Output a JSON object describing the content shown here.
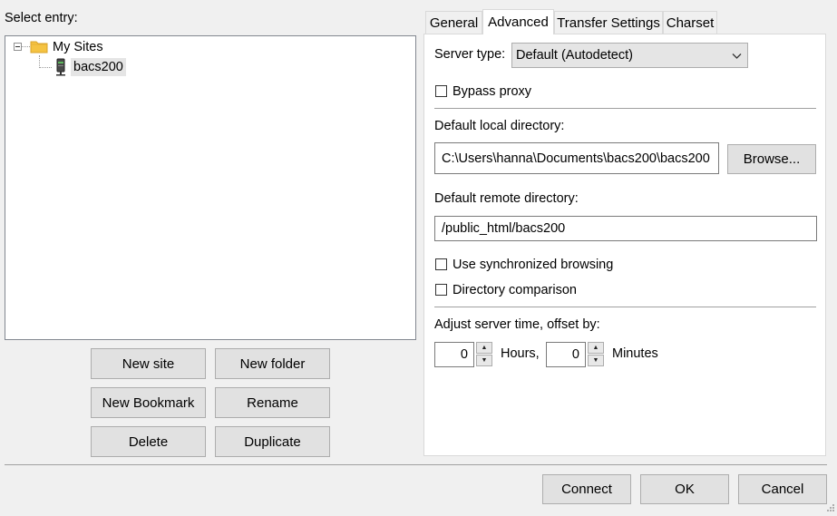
{
  "left": {
    "select_entry_label": "Select entry:",
    "tree": {
      "root_label": "My Sites",
      "child_label": "bacs200"
    },
    "buttons": {
      "new_site": "New site",
      "new_folder": "New folder",
      "new_bookmark": "New Bookmark",
      "rename": "Rename",
      "delete": "Delete",
      "duplicate": "Duplicate"
    }
  },
  "tabs": [
    {
      "label": "General",
      "active": false
    },
    {
      "label": "Advanced",
      "active": true
    },
    {
      "label": "Transfer Settings",
      "active": false
    },
    {
      "label": "Charset",
      "active": false
    }
  ],
  "advanced": {
    "server_type_label": "Server type:",
    "server_type_value": "Default (Autodetect)",
    "bypass_proxy_label": "Bypass proxy",
    "bypass_proxy_checked": false,
    "default_local_dir_label": "Default local directory:",
    "default_local_dir_value": "C:\\Users\\hanna\\Documents\\bacs200\\bacs200",
    "browse_label": "Browse...",
    "default_remote_dir_label": "Default remote directory:",
    "default_remote_dir_value": "/public_html/bacs200",
    "sync_browsing_label": "Use synchronized browsing",
    "sync_browsing_checked": false,
    "dir_comparison_label": "Directory comparison",
    "dir_comparison_checked": false,
    "time_offset_label": "Adjust server time, offset by:",
    "hours_value": "0",
    "hours_label": "Hours,",
    "minutes_value": "0",
    "minutes_label": "Minutes"
  },
  "footer": {
    "connect": "Connect",
    "ok": "OK",
    "cancel": "Cancel"
  },
  "colors": {
    "dialog_bg": "#f0f0f0",
    "button_bg": "#e1e1e1",
    "folder_yellow": "#f5c342"
  }
}
